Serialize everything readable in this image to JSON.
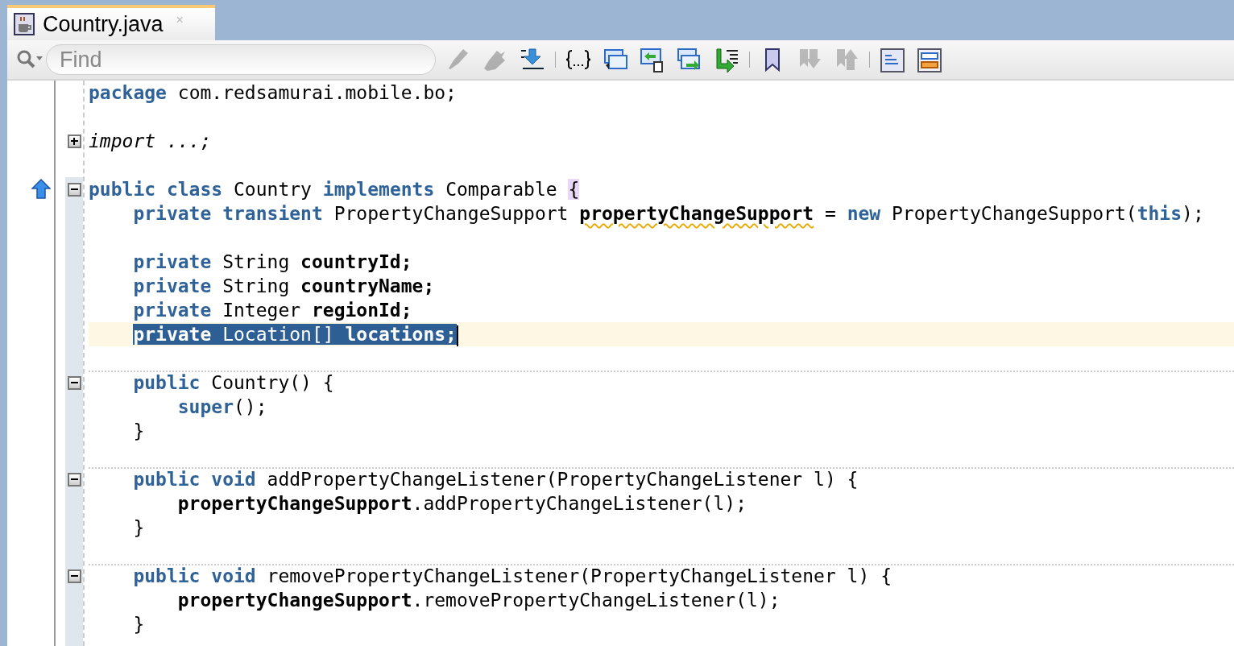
{
  "tab": {
    "title": "Country.java",
    "selected": true,
    "close": "×"
  },
  "find": {
    "placeholder": "Find"
  },
  "toolbar_groups": [
    [
      {
        "disabled": true
      },
      {
        "disabled": true
      },
      {
        "disabled": false
      }
    ],
    [
      {
        "disabled": false
      },
      {
        "disabled": false
      },
      {
        "disabled": false
      },
      {
        "disabled": false
      },
      {
        "disabled": false
      }
    ],
    [
      {
        "disabled": false
      },
      {
        "disabled": true
      },
      {
        "disabled": true
      }
    ],
    [
      {
        "disabled": false
      },
      {
        "disabled": false
      }
    ]
  ],
  "lines": [
    {
      "kind": "code",
      "tokens": [
        {
          "kind": "kw",
          "text": "package"
        },
        {
          "kind": "plain",
          "text": " com.redsamurai.mobile.bo;"
        }
      ]
    },
    {
      "kind": "blank"
    },
    {
      "kind": "code",
      "expanded": false,
      "tokens": [
        {
          "kind": "italic",
          "text": "import ...;"
        }
      ]
    },
    {
      "kind": "blank"
    },
    {
      "kind": "code",
      "overrides": true,
      "expanded": true,
      "tokens": [
        {
          "kind": "kw",
          "text": "public class"
        },
        {
          "kind": "plain",
          "text": " Country "
        },
        {
          "kind": "kw",
          "text": "implements"
        },
        {
          "kind": "plain",
          "text": " Comparable "
        },
        {
          "kind": "match",
          "text": "{"
        }
      ],
      "children": [
        {
          "kind": "code",
          "tokens": [
            {
              "kind": "kw",
              "text": "private transient"
            },
            {
              "kind": "plain",
              "text": " PropertyChangeSupport "
            },
            {
              "kind": "warn",
              "text": "propertyChangeSupport"
            },
            {
              "kind": "plain",
              "text": " = "
            },
            {
              "kind": "kw",
              "text": "new"
            },
            {
              "kind": "plain",
              "text": " PropertyChangeSupport("
            },
            {
              "kind": "kw",
              "text": "this"
            },
            {
              "kind": "plain",
              "text": ");"
            }
          ]
        },
        {
          "kind": "blank"
        },
        {
          "kind": "code",
          "tokens": [
            {
              "kind": "kw",
              "text": "private"
            },
            {
              "kind": "plain",
              "text": " String "
            },
            {
              "kind": "field",
              "text": "countryId;"
            }
          ]
        },
        {
          "kind": "code",
          "tokens": [
            {
              "kind": "kw",
              "text": "private"
            },
            {
              "kind": "plain",
              "text": " String "
            },
            {
              "kind": "field",
              "text": "countryName;"
            }
          ]
        },
        {
          "kind": "code",
          "tokens": [
            {
              "kind": "kw",
              "text": "private"
            },
            {
              "kind": "plain",
              "text": " Integer "
            },
            {
              "kind": "field",
              "text": "regionId;"
            }
          ]
        },
        {
          "kind": "code",
          "current": true,
          "selected": true,
          "tokens": [
            {
              "kind": "kw",
              "text": "private"
            },
            {
              "kind": "plain",
              "text": " Location[] "
            },
            {
              "kind": "field",
              "text": "locations;"
            }
          ]
        },
        {
          "kind": "blank"
        },
        {
          "kind": "code",
          "separator": true,
          "expanded": true,
          "tokens": [
            {
              "kind": "kw",
              "text": "public"
            },
            {
              "kind": "plain",
              "text": " Country() {"
            }
          ],
          "children": [
            {
              "kind": "code",
              "tokens": [
                {
                  "kind": "kw",
                  "text": "super"
                },
                {
                  "kind": "plain",
                  "text": "();"
                }
              ]
            }
          ]
        },
        {
          "kind": "code",
          "tokens": [
            {
              "kind": "plain",
              "text": "}"
            }
          ]
        },
        {
          "kind": "blank"
        },
        {
          "kind": "code",
          "separator": true,
          "expanded": true,
          "tokens": [
            {
              "kind": "kw",
              "text": "public void"
            },
            {
              "kind": "plain",
              "text": " addPropertyChangeListener(PropertyChangeListener l) {"
            }
          ],
          "children": [
            {
              "kind": "code",
              "tokens": [
                {
                  "kind": "field",
                  "text": "propertyChangeSupport"
                },
                {
                  "kind": "plain",
                  "text": ".addPropertyChangeListener(l);"
                }
              ]
            }
          ]
        },
        {
          "kind": "code",
          "tokens": [
            {
              "kind": "plain",
              "text": "}"
            }
          ]
        },
        {
          "kind": "blank"
        },
        {
          "kind": "code",
          "separator": true,
          "expanded": true,
          "tokens": [
            {
              "kind": "kw",
              "text": "public void"
            },
            {
              "kind": "plain",
              "text": " removePropertyChangeListener(PropertyChangeListener l) {"
            }
          ],
          "children": [
            {
              "kind": "code",
              "tokens": [
                {
                  "kind": "field",
                  "text": "propertyChangeSupport"
                },
                {
                  "kind": "plain",
                  "text": ".removePropertyChangeListener(l);"
                }
              ]
            }
          ]
        },
        {
          "kind": "code",
          "tokens": [
            {
              "kind": "plain",
              "text": "}"
            }
          ]
        }
      ]
    }
  ]
}
